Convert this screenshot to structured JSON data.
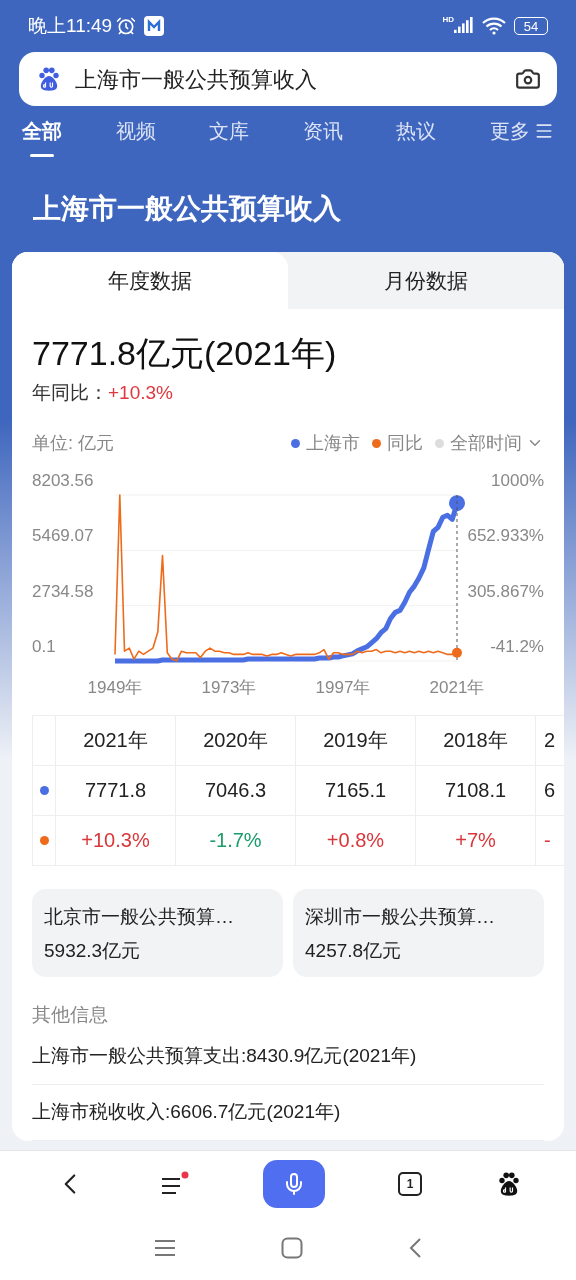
{
  "status_bar": {
    "time": "晚上11:49",
    "network": "HD",
    "battery": "54"
  },
  "search": {
    "value": "上海市一般公共预算收入"
  },
  "tabs": [
    {
      "label": "全部",
      "selected": true
    },
    {
      "label": "视频",
      "selected": false
    },
    {
      "label": "文库",
      "selected": false
    },
    {
      "label": "资讯",
      "selected": false
    },
    {
      "label": "热议",
      "selected": false
    },
    {
      "label": "更多",
      "selected": false
    }
  ],
  "title": "上海市一般公共预算收入",
  "card": {
    "tabs": [
      {
        "label": "年度数据",
        "selected": true
      },
      {
        "label": "月份数据",
        "selected": false
      }
    ],
    "headline": "7771.8亿元(2021年)",
    "yoy_label": "年同比：",
    "yoy_value": "+10.3%",
    "unit": "单位: 亿元",
    "time_range": "全部时间",
    "value_chart": {
      "chart_data": {
        "type": "line",
        "x": [
          1949,
          1950,
          1951,
          1952,
          1953,
          1954,
          1955,
          1956,
          1957,
          1958,
          1959,
          1960,
          1961,
          1962,
          1963,
          1964,
          1965,
          1966,
          1967,
          1968,
          1969,
          1970,
          1971,
          1972,
          1973,
          1974,
          1975,
          1976,
          1977,
          1978,
          1979,
          1980,
          1981,
          1982,
          1983,
          1984,
          1985,
          1986,
          1987,
          1988,
          1989,
          1990,
          1991,
          1992,
          1993,
          1994,
          1995,
          1996,
          1997,
          1998,
          1999,
          2000,
          2001,
          2002,
          2003,
          2004,
          2005,
          2006,
          2007,
          2008,
          2009,
          2010,
          2011,
          2012,
          2013,
          2014,
          2015,
          2016,
          2017,
          2018,
          2019,
          2020,
          2021
        ],
        "series": [
          {
            "name": "上海市",
            "color": "#4a6fe3",
            "values": [
              0.1,
              0.1,
              0.1,
              0.1,
              0.1,
              0.1,
              0.1,
              0.1,
              0.1,
              0.1,
              50,
              50,
              50,
              50,
              50,
              50,
              50,
              50,
              50,
              50,
              50,
              50,
              50,
              50,
              50,
              50,
              50,
              50,
              100,
              100,
              100,
              100,
              100,
              100,
              100,
              100,
              100,
              100,
              100,
              100,
              100,
              100,
              100,
              150,
              150,
              150,
              200,
              200,
              250,
              300,
              350,
              500,
              600,
              700,
              900,
              1100,
              1400,
              1600,
              2100,
              2400,
              2500,
              2900,
              3400,
              3700,
              4100,
              4600,
              5500,
              6400,
              6600,
              7100,
              7200,
              7000,
              7800
            ]
          }
        ],
        "xlim": [
          1949,
          2021
        ],
        "xticks": [
          {
            "value": 1949,
            "label": "1949年"
          },
          {
            "value": 1973,
            "label": "1973年"
          },
          {
            "value": 1997,
            "label": "1997年"
          },
          {
            "value": 2021,
            "label": "2021年"
          }
        ],
        "yticks": [
          {
            "value": 8203.56,
            "label": "8203.56"
          },
          {
            "value": 5469.07,
            "label": "5469.07"
          },
          {
            "value": 2734.58,
            "label": "2734.58"
          },
          {
            "value": 0.1,
            "label": "0.1"
          }
        ],
        "ylim": [
          0.1,
          8203.56
        ]
      }
    },
    "yoy_chart": {
      "chart_data": {
        "type": "line",
        "x": [
          1949,
          1950,
          1951,
          1952,
          1953,
          1954,
          1955,
          1956,
          1957,
          1958,
          1959,
          1960,
          1961,
          1962,
          1963,
          1964,
          1965,
          1966,
          1967,
          1968,
          1969,
          1970,
          1971,
          1972,
          1973,
          1974,
          1975,
          1976,
          1977,
          1978,
          1979,
          1980,
          1981,
          1982,
          1983,
          1984,
          1985,
          1986,
          1987,
          1988,
          1989,
          1990,
          1991,
          1992,
          1993,
          1994,
          1995,
          1996,
          1997,
          1998,
          1999,
          2000,
          2001,
          2002,
          2003,
          2004,
          2005,
          2006,
          2007,
          2008,
          2009,
          2010,
          2011,
          2012,
          2013,
          2014,
          2015,
          2016,
          2017,
          2018,
          2019,
          2020,
          2021
        ],
        "series": [
          {
            "name": "同比",
            "color": "#ee6b1c",
            "values": [
              0,
              1000,
              20,
              40,
              -30,
              20,
              0,
              20,
              40,
              140,
              620,
              10,
              -30,
              -40,
              20,
              10,
              10,
              10,
              -20,
              20,
              40,
              20,
              20,
              10,
              10,
              0,
              0,
              0,
              10,
              0,
              0,
              0,
              -10,
              0,
              0,
              10,
              0,
              -10,
              0,
              0,
              0,
              0,
              0,
              10,
              30,
              -30,
              10,
              10,
              0,
              0,
              0,
              20,
              10,
              20,
              20,
              30,
              10,
              20,
              20,
              10,
              20,
              10,
              20,
              10,
              20,
              10,
              20,
              10,
              20,
              10,
              0,
              0,
              10
            ]
          }
        ],
        "xlim": [
          1949,
          2021
        ],
        "yticks": [
          {
            "value": 1000,
            "label": "1000%"
          },
          {
            "value": 652.933,
            "label": "652.933%"
          },
          {
            "value": 305.867,
            "label": "305.867%"
          },
          {
            "value": -41.2,
            "label": "-41.2%"
          }
        ],
        "ylim": [
          -41.2,
          1000
        ]
      }
    },
    "table": {
      "columns": [
        "2021年",
        "2020年",
        "2019年",
        "2018年",
        "2"
      ],
      "rows": [
        {
          "color": "#4a6fe3",
          "cells": [
            {
              "text": "7771.8"
            },
            {
              "text": "7046.3"
            },
            {
              "text": "7165.1"
            },
            {
              "text": "7108.1"
            },
            {
              "text": "6"
            }
          ]
        },
        {
          "color": "#ee6b1c",
          "cells": [
            {
              "text": "+10.3%",
              "positive": true
            },
            {
              "text": "-1.7%",
              "positive": false
            },
            {
              "text": "+0.8%",
              "positive": true
            },
            {
              "text": "+7%",
              "positive": true
            },
            {
              "text": "-",
              "positive": true
            }
          ]
        }
      ]
    }
  },
  "related": [
    {
      "title": "北京市一般公共预算…",
      "value": "5932.3亿元"
    },
    {
      "title": "深圳市一般公共预算…",
      "value": "4257.8亿元"
    }
  ],
  "other_info": {
    "heading": "其他信息",
    "items": [
      "上海市一般公共预算支出:8430.9亿元(2021年)",
      "上海市税收收入:6606.7亿元(2021年)"
    ]
  },
  "bottom_nav": {
    "tab_count": "1"
  }
}
